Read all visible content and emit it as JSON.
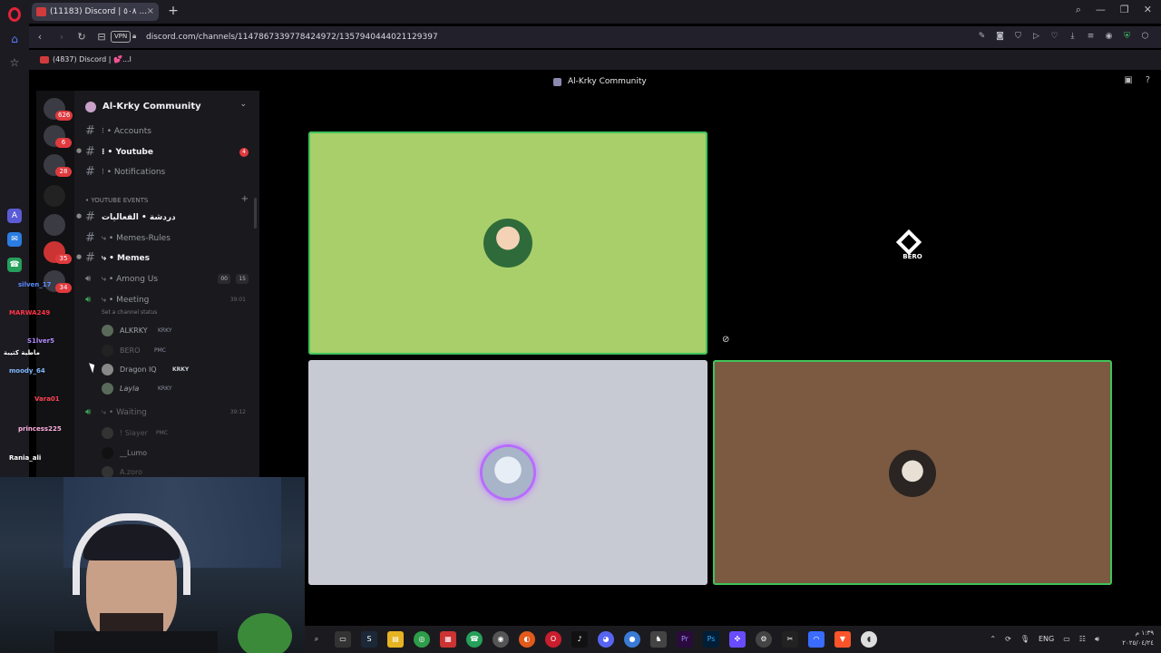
{
  "browser": {
    "tab_title": "(11183) Discord | ٥٠٨ ...",
    "url": "discord.com/channels/1147867339778424972/1357940444021129397",
    "vpn_label": "VPN",
    "bookmark": "(4837) Discord | 💕...l"
  },
  "server": {
    "name": "Al-Krky Community",
    "top_title": "Al-Krky Community"
  },
  "guild_badges": [
    "626",
    "6",
    "28",
    "35",
    "34"
  ],
  "channels": {
    "accounts": "⁝ • Accounts",
    "youtube": "⁝ • Youtube",
    "youtube_badge": "4",
    "notifications": "⁝ • Notifications",
    "category": "• YOUTUBE EVENTS",
    "events_chat": "دردشة • الفعاليات",
    "memes_rules": "⤷ • Memes-Rules",
    "memes": "⤷ • Memes",
    "among_us": "⤷ • Among Us",
    "among_us_count_a": "00",
    "among_us_count_b": "15",
    "meeting": "⤷ • Meeting",
    "meeting_time": "39:01",
    "set_status": "Set a channel status",
    "waiting": "⤷ • Waiting",
    "waiting_time": "39:12"
  },
  "voice_users": [
    {
      "name": "ALKRKY",
      "tag": "KRKY"
    },
    {
      "name": "BERO",
      "tag": "PMC"
    },
    {
      "name": "Dragon IQ",
      "tag": "KRKY"
    },
    {
      "name": "Layla",
      "tag": "KRKY"
    },
    {
      "name": "! Slayer",
      "tag": "PMC"
    },
    {
      "name": "__Lumo",
      "tag": ""
    },
    {
      "name": "A.zoro",
      "tag": ""
    }
  ],
  "chat_names": [
    "silven_17",
    "MARWA249",
    "ماطية كتيبة",
    "S1lver5",
    "moody_64",
    "Vara01",
    "princess225",
    "Rania_ali"
  ],
  "tiles": {
    "bero_label": "BERO"
  },
  "taskbar": {
    "lang": "ENG",
    "time": "١:٣٩ م",
    "date": "٢٠٢٥/٠٤/٢٤"
  },
  "colors": {
    "green_tile": "#a9cf6b",
    "grey_tile": "#c8cad3",
    "brown_tile": "#7b5a41",
    "speaking_outline": "#3fc35a"
  }
}
